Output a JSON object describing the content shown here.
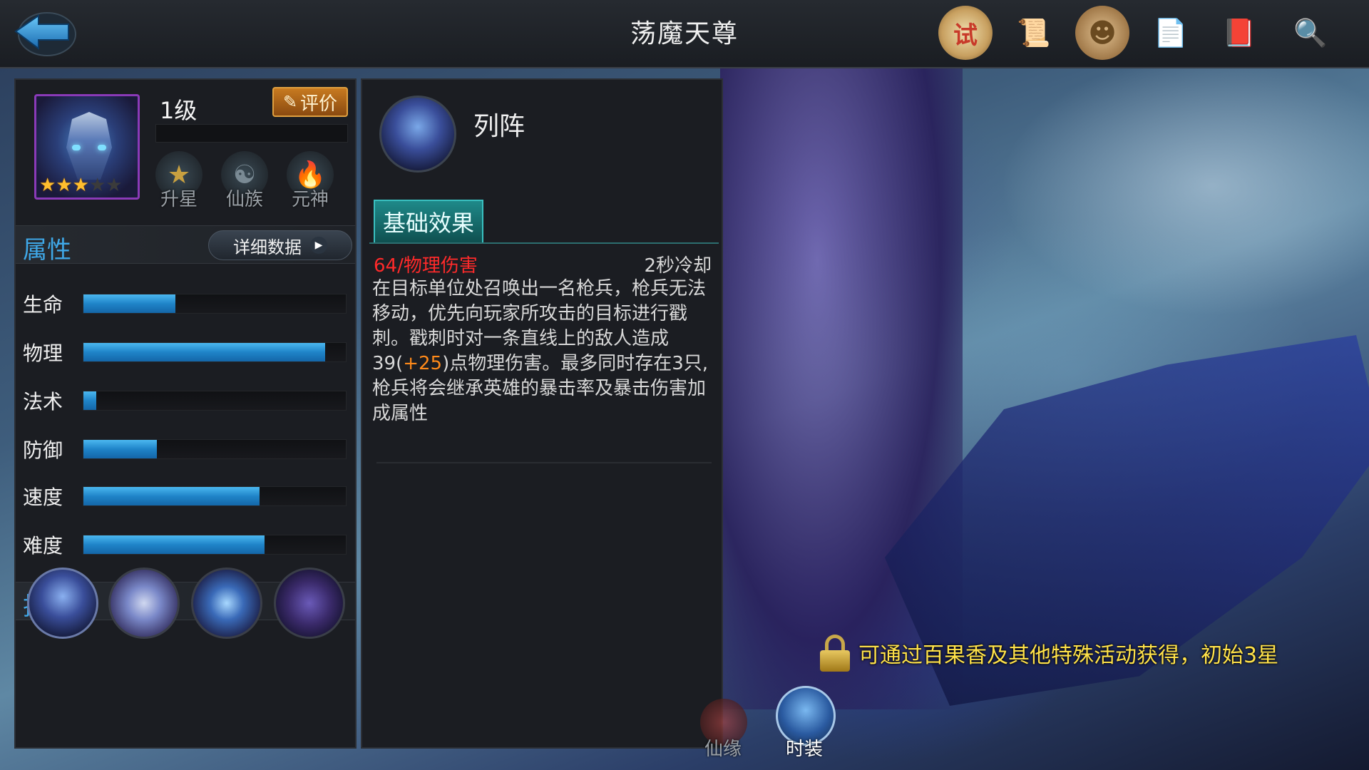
{
  "header": {
    "title": "荡魔天尊",
    "icons": [
      {
        "name": "challenge-icon",
        "glyph": "试",
        "color": "#c83a2a"
      },
      {
        "name": "scroll-icon",
        "glyph": "📜",
        "color": "#c8a460"
      },
      {
        "name": "medal-icon",
        "glyph": "☻",
        "color": "#b8905a"
      },
      {
        "name": "notes-icon",
        "glyph": "📄",
        "color": "#d8c8a0"
      },
      {
        "name": "book-icon",
        "glyph": "📕",
        "color": "#a03a2a"
      },
      {
        "name": "magnifier-icon",
        "glyph": "🔍",
        "color": "#8aa0b8"
      }
    ]
  },
  "hero": {
    "level": "1级",
    "stars_filled": 3,
    "stars_total": 5,
    "rate_label": "评价",
    "buttons": [
      "升星",
      "仙族",
      "元神"
    ]
  },
  "attributes": {
    "title": "属性",
    "detail_label": "详细数据",
    "stats": [
      {
        "label": "生命",
        "value": 0.35
      },
      {
        "label": "物理",
        "value": 0.92
      },
      {
        "label": "法术",
        "value": 0.05
      },
      {
        "label": "防御",
        "value": 0.28
      },
      {
        "label": "速度",
        "value": 0.67
      },
      {
        "label": "难度",
        "value": 0.69
      }
    ]
  },
  "skills": {
    "title": "技能",
    "icons": [
      "skill-1-icon",
      "skill-2-icon",
      "skill-3-icon",
      "skill-4-icon"
    ]
  },
  "skill_detail": {
    "name": "列阵",
    "tab_label": "基础效果",
    "damage": "64/物理伤害",
    "cooldown": "2秒冷却",
    "desc_part1": "在目标单位处召唤出一名枪兵，枪兵无法移动，优先向玩家所攻击的目标进行戳刺。戳刺时对一条直线上的敌人造成39(",
    "desc_highlight": "+25",
    "desc_part2": ")点物理伤害。最多同时存在3只,枪兵将会继承英雄的暴击率及暴击伤害加成属性"
  },
  "notice": {
    "text": "可通过百果香及其他特殊活动获得，初始3星"
  },
  "bottom_tabs": {
    "items": [
      "仙缘",
      "时装"
    ],
    "active": "时装"
  },
  "colors": {
    "accent_blue": "#3fa8e8",
    "damage_red": "#ff2a2a",
    "highlight_orange": "#ff8a1a",
    "notice_yellow": "#ffe24a",
    "tab_teal": "#1f8a8a"
  }
}
